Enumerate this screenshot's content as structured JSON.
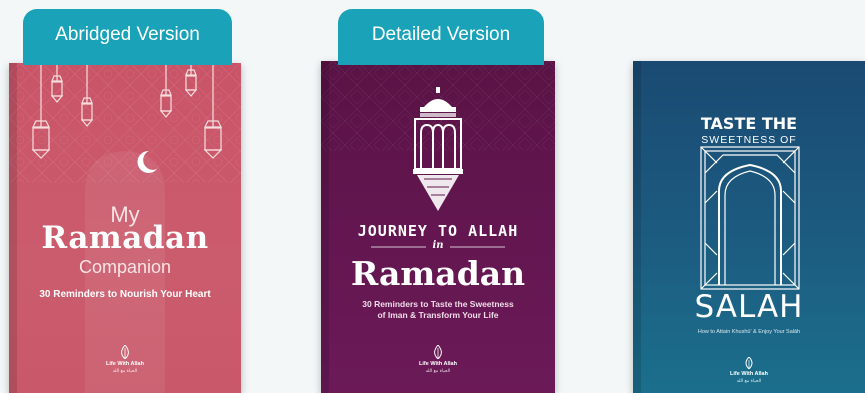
{
  "tabs": [
    "Abridged Version",
    "Detailed Version"
  ],
  "books": [
    {
      "title_prefix": "My",
      "title_main": "Ramadan",
      "title_suffix": "Companion",
      "subtitle": "30 Reminders to Nourish Your Heart",
      "publisher": "Life With Allah",
      "publisher_arabic": "الحياة مع الله",
      "color": "#c95468"
    },
    {
      "title_top": "JOURNEY TO ALLAH",
      "title_connector": "in",
      "title_main": "Ramadan",
      "subtitle_line1": "30 Reminders to Taste the Sweetness",
      "subtitle_line2": "of Iman & Transform Your Life",
      "publisher": "Life With Allah",
      "publisher_arabic": "الحياة مع الله",
      "color": "#5f1549"
    },
    {
      "title_top": "TASTE THE",
      "title_sub": "SWEETNESS OF",
      "title_main": "SALAH",
      "subtitle": "How to Attain Khushū' & Enjoy Your Salāh",
      "publisher": "Life With Allah",
      "publisher_arabic": "الحياة مع الله",
      "color": "#1b5479"
    }
  ]
}
